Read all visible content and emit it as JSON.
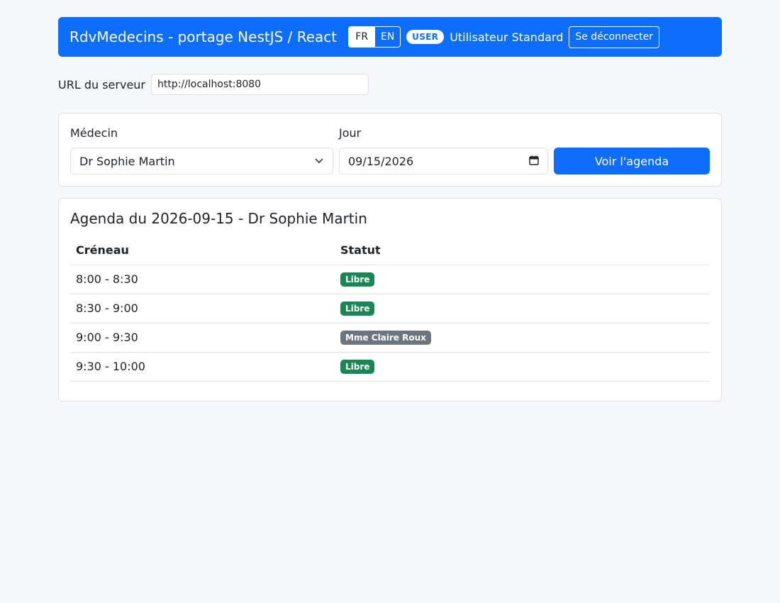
{
  "header": {
    "title": "RdvMedecins - portage NestJS / React",
    "languages": [
      {
        "label": "FR",
        "active": true
      },
      {
        "label": "EN",
        "active": false
      }
    ],
    "role_badge": "USER",
    "user_name": "Utilisateur Standard",
    "logout_label": "Se déconnecter"
  },
  "server": {
    "label": "URL du serveur",
    "value": "http://localhost:8080"
  },
  "filters": {
    "doctor_label": "Médecin",
    "doctor_value": "Dr Sophie Martin",
    "day_label": "Jour",
    "day_value": "09/15/2026",
    "submit_label": "Voir l'agenda"
  },
  "agenda": {
    "title": "Agenda du 2026-09-15 - Dr Sophie Martin",
    "columns": [
      "Créneau",
      "Statut"
    ],
    "rows": [
      {
        "slot": "8:00 - 8:30",
        "status": "Libre",
        "status_type": "free"
      },
      {
        "slot": "8:30 - 9:00",
        "status": "Libre",
        "status_type": "free"
      },
      {
        "slot": "9:00 - 9:30",
        "status": "Mme Claire Roux",
        "status_type": "busy"
      },
      {
        "slot": "9:30 - 10:00",
        "status": "Libre",
        "status_type": "free"
      }
    ]
  },
  "colors": {
    "primary": "#0d6efd",
    "success": "#198754",
    "secondary": "#6c757d",
    "background": "#f5f7fa"
  }
}
